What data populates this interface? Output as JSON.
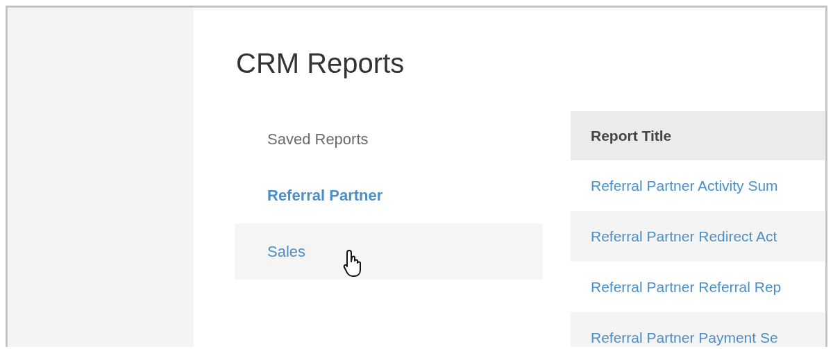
{
  "page": {
    "title": "CRM Reports"
  },
  "sidebar": {
    "items": [
      {
        "label": "Saved Reports",
        "kind": "heading",
        "selected": false,
        "hovered": false
      },
      {
        "label": "Referral Partner",
        "kind": "link",
        "selected": true,
        "hovered": false
      },
      {
        "label": "Sales",
        "kind": "link",
        "selected": false,
        "hovered": true
      }
    ]
  },
  "table": {
    "columns": [
      "Report Title"
    ],
    "rows": [
      [
        "Referral Partner Activity Sum"
      ],
      [
        "Referral Partner Redirect Act"
      ],
      [
        "Referral Partner Referral Rep"
      ],
      [
        "Referral Partner Payment Se"
      ]
    ]
  }
}
